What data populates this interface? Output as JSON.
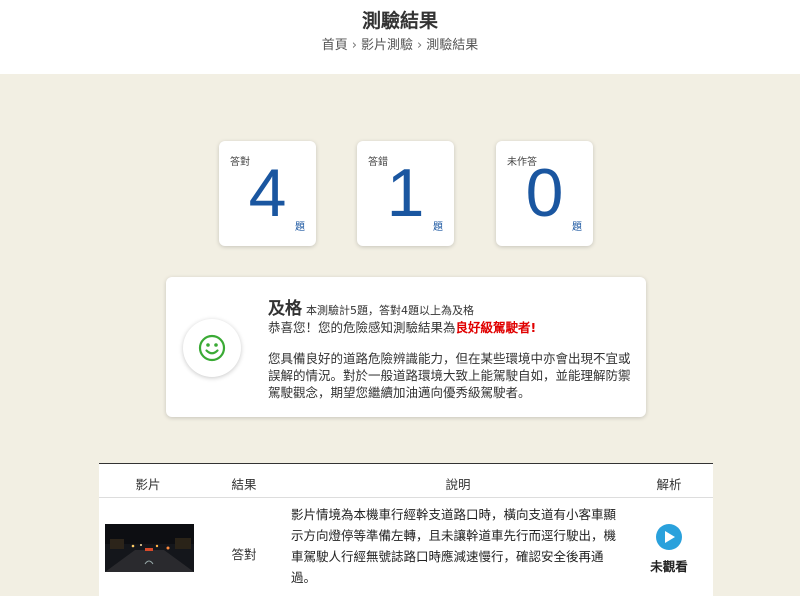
{
  "header": {
    "title": "測驗結果",
    "breadcrumb": [
      "首頁",
      "影片測驗",
      "測驗結果"
    ],
    "separator": "›"
  },
  "scores": [
    {
      "label": "答對",
      "value": "4",
      "unit": "題"
    },
    {
      "label": "答錯",
      "value": "1",
      "unit": "題"
    },
    {
      "label": "未作答",
      "value": "0",
      "unit": "題"
    }
  ],
  "result": {
    "icon": "smile-icon",
    "title": "及格",
    "rule": "本測驗計5題，答對4題以上為及格",
    "congrats_prefix": "恭喜您！您的危險感知測驗結果為",
    "level": "良好級駕駛者",
    "congrats_suffix": "!",
    "description": "您具備良好的道路危險辨識能力，但在某些環境中亦會出現不宜或誤解的情況。對於一般道路環境大致上能駕駛自如，並能理解防禦駕駛觀念，期望您繼續加油邁向優秀級駕駛者。"
  },
  "table": {
    "headers": {
      "video": "影片",
      "result": "結果",
      "explanation": "說明",
      "analysis": "解析"
    },
    "rows": [
      {
        "result": "答對",
        "description": "影片情境為本機車行經幹支道路口時，橫向支道有小客車顯示方向燈停等準備左轉，且未讓幹道車先行而逕行駛出，機車駕駛人行經無號誌路口時應減速慢行，確認安全後再通過。",
        "status": "未觀看",
        "play_icon": "play-icon"
      }
    ]
  },
  "colors": {
    "page_bg": "#f2efe3",
    "number_blue": "#1a56a0",
    "highlight_red": "#e00000",
    "smile_green": "#3aaa35",
    "play_blue": "#2aa1dc"
  }
}
